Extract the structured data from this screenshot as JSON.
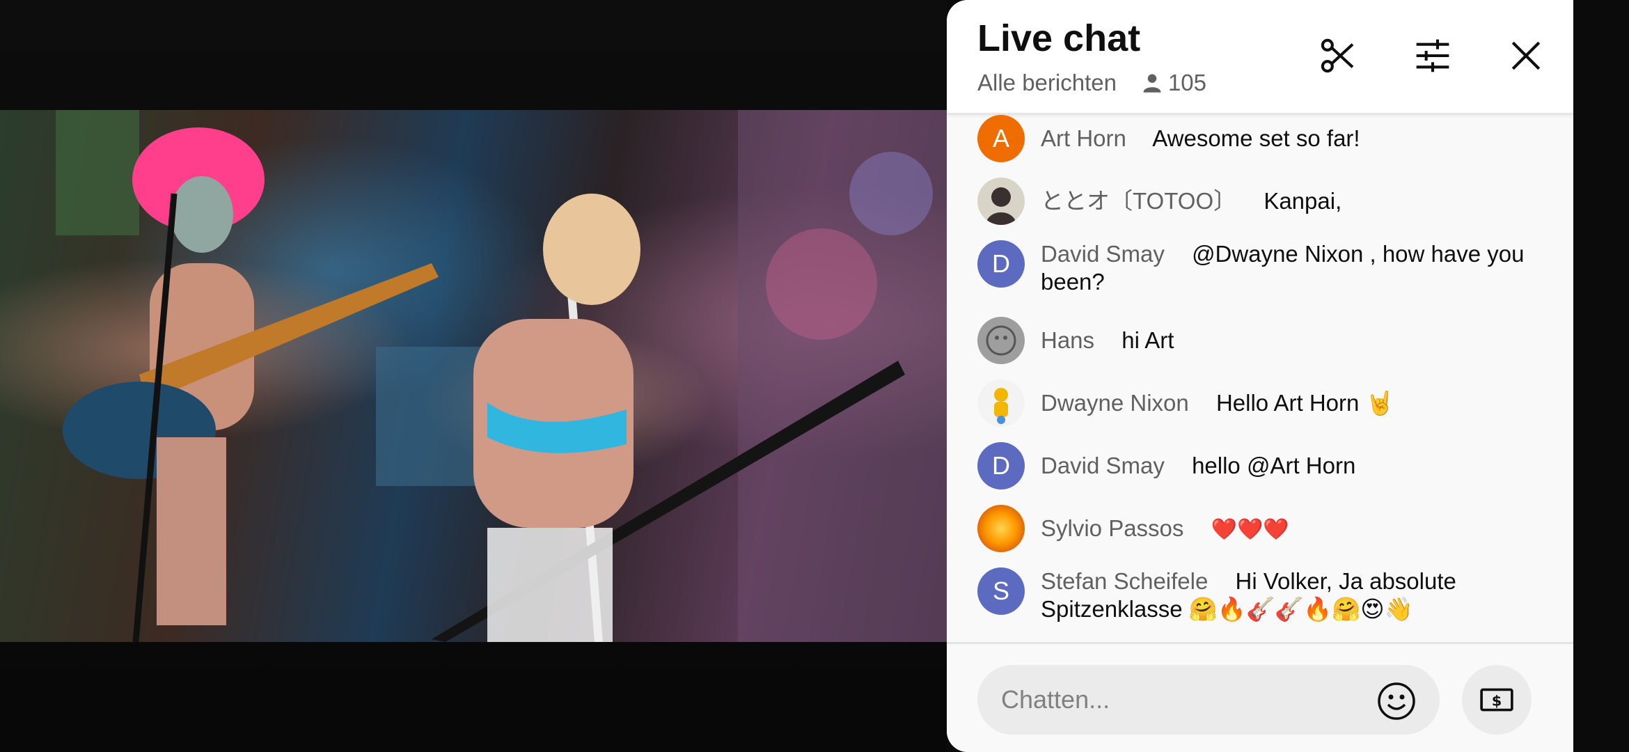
{
  "video": {
    "description_icon": "live-video-frame"
  },
  "chat": {
    "title": "Live chat",
    "filter_label": "Alle berichten",
    "viewer_count": "105",
    "icons": {
      "clip": "scissors-icon",
      "settings": "sliders-icon",
      "close": "close-icon",
      "viewers": "person-icon"
    },
    "messages": [
      {
        "author": "Art Horn",
        "text": "Awesome set so far!",
        "avatar_letter": "A",
        "avatar_color": "#ef6c00"
      },
      {
        "author": "ととオ〔TOTOO〕",
        "text": "Kanpai,",
        "avatar_letter": "",
        "avatar_color": "#d9d4c8"
      },
      {
        "author": "David Smay",
        "text": "@Dwayne Nixon , how have you been?",
        "avatar_letter": "D",
        "avatar_color": "#5c6bc0"
      },
      {
        "author": "Hans",
        "text": "hi Art",
        "avatar_letter": "",
        "avatar_color": "#9e9e9e"
      },
      {
        "author": "Dwayne Nixon",
        "text": "Hello Art Horn 🤘",
        "avatar_letter": "",
        "avatar_color": "#f3f3f3"
      },
      {
        "author": "David Smay",
        "text": "hello @Art Horn",
        "avatar_letter": "D",
        "avatar_color": "#5c6bc0"
      },
      {
        "author": "Sylvio Passos",
        "text": "❤️❤️❤️",
        "avatar_letter": "",
        "avatar_color": "#e65100"
      },
      {
        "author": "Stefan Scheifele",
        "text": "Hi Volker, Ja absolute Spitzenklasse 🤗🔥🎸🎸🔥🤗😍👋",
        "avatar_letter": "S",
        "avatar_color": "#5c6bc0"
      }
    ],
    "input_placeholder": "Chatten...",
    "emoji_icon": "smiley-icon",
    "super_chat_icon": "dollar-bill-icon"
  }
}
